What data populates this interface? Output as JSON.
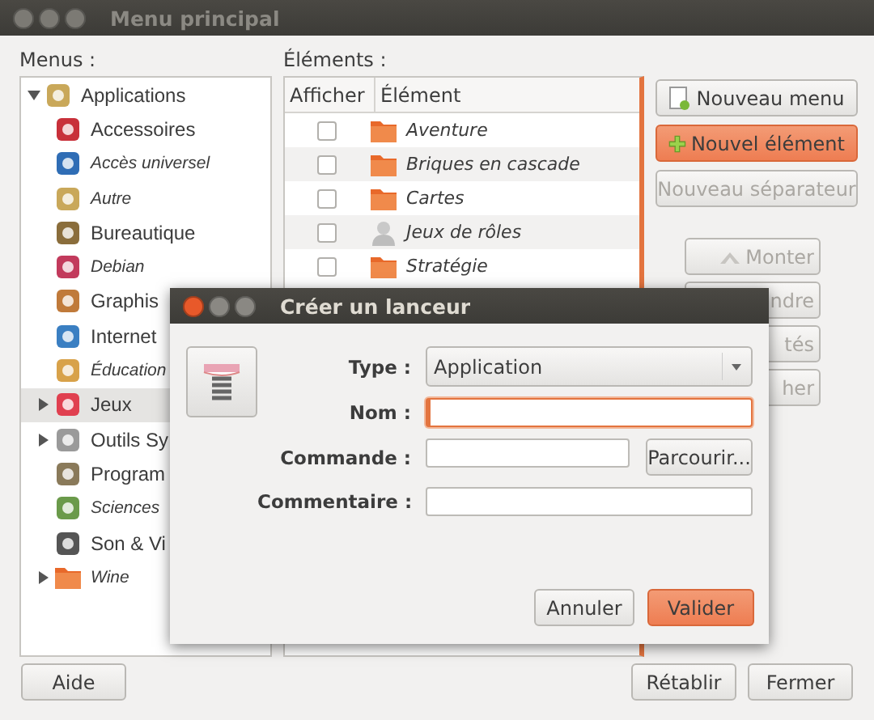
{
  "window": {
    "title": "Menu principal"
  },
  "menus_label": "Menus :",
  "menu_tree": [
    {
      "label": "Applications",
      "shown": true,
      "expanded": true,
      "selected": false,
      "children": [
        {
          "label": "Accessoires",
          "shown": true,
          "selected": false
        },
        {
          "label": "Accès universel",
          "shown": false,
          "selected": false
        },
        {
          "label": "Autre",
          "shown": false,
          "selected": false
        },
        {
          "label": "Bureautique",
          "shown": true,
          "selected": false
        },
        {
          "label": "Debian",
          "shown": false,
          "selected": false
        },
        {
          "label": "Graphis",
          "shown": true,
          "selected": false
        },
        {
          "label": "Internet",
          "shown": true,
          "selected": false
        },
        {
          "label": "Éducation",
          "shown": false,
          "selected": false
        },
        {
          "label": "Jeux",
          "shown": true,
          "expanded": false,
          "selected": true
        },
        {
          "label": "Outils Sy",
          "shown": true,
          "expanded": false,
          "selected": false
        },
        {
          "label": "Program",
          "shown": true,
          "selected": false
        },
        {
          "label": "Sciences",
          "shown": false,
          "selected": false
        },
        {
          "label": "Son & Vi",
          "shown": true,
          "selected": false
        },
        {
          "label": "Wine",
          "shown": false,
          "expanded": false,
          "selected": false
        }
      ]
    }
  ],
  "elements_label": "Éléments :",
  "table": {
    "columns": [
      "Afficher",
      "Élément"
    ],
    "rows": [
      {
        "label": "Aventure",
        "kind": "directory",
        "checked": false
      },
      {
        "label": "Briques en cascade",
        "kind": "directory",
        "checked": false
      },
      {
        "label": "Cartes",
        "kind": "directory",
        "checked": false
      },
      {
        "label": "Jeux de rôles",
        "kind": "entry",
        "checked": false
      },
      {
        "label": "Stratégie",
        "kind": "directory",
        "checked": false
      }
    ]
  },
  "side_buttons": [
    {
      "label": "Nouveau menu",
      "kind": "new-menu",
      "disabled": false,
      "default": false
    },
    {
      "label": "Nouvel élément",
      "kind": "new-item",
      "disabled": false,
      "default": true
    },
    {
      "label": "Nouveau séparateur",
      "kind": "plain",
      "disabled": true,
      "default": false
    }
  ],
  "move_buttons": [
    {
      "label": "Monter",
      "kind": "up",
      "disabled": true
    },
    {
      "label": "ndre",
      "kind": "plain",
      "disabled": true
    },
    {
      "label": "tés",
      "kind": "plain",
      "disabled": true
    },
    {
      "label": "her",
      "kind": "plain",
      "disabled": true
    }
  ],
  "bottom_buttons": {
    "left": [
      "Aide"
    ],
    "right": [
      "Rétablir",
      "Fermer"
    ]
  },
  "dialog": {
    "title": "Créer un lanceur",
    "fields": [
      {
        "label": "Type :",
        "kind": "combo",
        "value": "Application",
        "focused": false
      },
      {
        "label": "Nom :",
        "kind": "text",
        "focused": true
      },
      {
        "label": "Commande :",
        "kind": "browse",
        "focused": false,
        "button": "Parcourir..."
      },
      {
        "label": "Commentaire :",
        "kind": "text",
        "focused": false
      }
    ],
    "buttons": [
      {
        "label": "Annuler",
        "default": false
      },
      {
        "label": "Valider",
        "default": true
      }
    ]
  }
}
